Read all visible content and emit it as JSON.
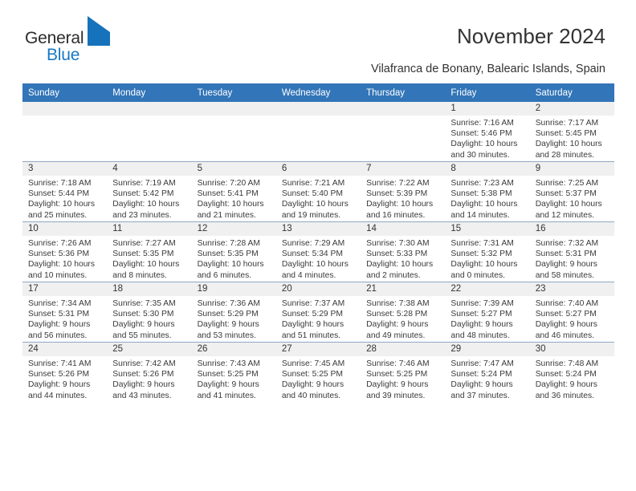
{
  "brand": {
    "name_part1": "General",
    "name_part2": "Blue",
    "accent_color": "#1673bb"
  },
  "header": {
    "title": "November 2024",
    "subtitle": "Vilafranca de Bonany, Balearic Islands, Spain"
  },
  "theme": {
    "header_row_bg": "#3275b8",
    "daynum_band_bg": "#f0f0f0",
    "grid_line": "#8fa8c4"
  },
  "weekday_headers": [
    "Sunday",
    "Monday",
    "Tuesday",
    "Wednesday",
    "Thursday",
    "Friday",
    "Saturday"
  ],
  "weeks": [
    [
      {
        "day": "",
        "empty": true
      },
      {
        "day": "",
        "empty": true
      },
      {
        "day": "",
        "empty": true
      },
      {
        "day": "",
        "empty": true
      },
      {
        "day": "",
        "empty": true
      },
      {
        "day": "1",
        "sunrise": "Sunrise: 7:16 AM",
        "sunset": "Sunset: 5:46 PM",
        "daylight_line1": "Daylight: 10 hours",
        "daylight_line2": "and 30 minutes."
      },
      {
        "day": "2",
        "sunrise": "Sunrise: 7:17 AM",
        "sunset": "Sunset: 5:45 PM",
        "daylight_line1": "Daylight: 10 hours",
        "daylight_line2": "and 28 minutes."
      }
    ],
    [
      {
        "day": "3",
        "sunrise": "Sunrise: 7:18 AM",
        "sunset": "Sunset: 5:44 PM",
        "daylight_line1": "Daylight: 10 hours",
        "daylight_line2": "and 25 minutes."
      },
      {
        "day": "4",
        "sunrise": "Sunrise: 7:19 AM",
        "sunset": "Sunset: 5:42 PM",
        "daylight_line1": "Daylight: 10 hours",
        "daylight_line2": "and 23 minutes."
      },
      {
        "day": "5",
        "sunrise": "Sunrise: 7:20 AM",
        "sunset": "Sunset: 5:41 PM",
        "daylight_line1": "Daylight: 10 hours",
        "daylight_line2": "and 21 minutes."
      },
      {
        "day": "6",
        "sunrise": "Sunrise: 7:21 AM",
        "sunset": "Sunset: 5:40 PM",
        "daylight_line1": "Daylight: 10 hours",
        "daylight_line2": "and 19 minutes."
      },
      {
        "day": "7",
        "sunrise": "Sunrise: 7:22 AM",
        "sunset": "Sunset: 5:39 PM",
        "daylight_line1": "Daylight: 10 hours",
        "daylight_line2": "and 16 minutes."
      },
      {
        "day": "8",
        "sunrise": "Sunrise: 7:23 AM",
        "sunset": "Sunset: 5:38 PM",
        "daylight_line1": "Daylight: 10 hours",
        "daylight_line2": "and 14 minutes."
      },
      {
        "day": "9",
        "sunrise": "Sunrise: 7:25 AM",
        "sunset": "Sunset: 5:37 PM",
        "daylight_line1": "Daylight: 10 hours",
        "daylight_line2": "and 12 minutes."
      }
    ],
    [
      {
        "day": "10",
        "sunrise": "Sunrise: 7:26 AM",
        "sunset": "Sunset: 5:36 PM",
        "daylight_line1": "Daylight: 10 hours",
        "daylight_line2": "and 10 minutes."
      },
      {
        "day": "11",
        "sunrise": "Sunrise: 7:27 AM",
        "sunset": "Sunset: 5:35 PM",
        "daylight_line1": "Daylight: 10 hours",
        "daylight_line2": "and 8 minutes."
      },
      {
        "day": "12",
        "sunrise": "Sunrise: 7:28 AM",
        "sunset": "Sunset: 5:35 PM",
        "daylight_line1": "Daylight: 10 hours",
        "daylight_line2": "and 6 minutes."
      },
      {
        "day": "13",
        "sunrise": "Sunrise: 7:29 AM",
        "sunset": "Sunset: 5:34 PM",
        "daylight_line1": "Daylight: 10 hours",
        "daylight_line2": "and 4 minutes."
      },
      {
        "day": "14",
        "sunrise": "Sunrise: 7:30 AM",
        "sunset": "Sunset: 5:33 PM",
        "daylight_line1": "Daylight: 10 hours",
        "daylight_line2": "and 2 minutes."
      },
      {
        "day": "15",
        "sunrise": "Sunrise: 7:31 AM",
        "sunset": "Sunset: 5:32 PM",
        "daylight_line1": "Daylight: 10 hours",
        "daylight_line2": "and 0 minutes."
      },
      {
        "day": "16",
        "sunrise": "Sunrise: 7:32 AM",
        "sunset": "Sunset: 5:31 PM",
        "daylight_line1": "Daylight: 9 hours",
        "daylight_line2": "and 58 minutes."
      }
    ],
    [
      {
        "day": "17",
        "sunrise": "Sunrise: 7:34 AM",
        "sunset": "Sunset: 5:31 PM",
        "daylight_line1": "Daylight: 9 hours",
        "daylight_line2": "and 56 minutes."
      },
      {
        "day": "18",
        "sunrise": "Sunrise: 7:35 AM",
        "sunset": "Sunset: 5:30 PM",
        "daylight_line1": "Daylight: 9 hours",
        "daylight_line2": "and 55 minutes."
      },
      {
        "day": "19",
        "sunrise": "Sunrise: 7:36 AM",
        "sunset": "Sunset: 5:29 PM",
        "daylight_line1": "Daylight: 9 hours",
        "daylight_line2": "and 53 minutes."
      },
      {
        "day": "20",
        "sunrise": "Sunrise: 7:37 AM",
        "sunset": "Sunset: 5:29 PM",
        "daylight_line1": "Daylight: 9 hours",
        "daylight_line2": "and 51 minutes."
      },
      {
        "day": "21",
        "sunrise": "Sunrise: 7:38 AM",
        "sunset": "Sunset: 5:28 PM",
        "daylight_line1": "Daylight: 9 hours",
        "daylight_line2": "and 49 minutes."
      },
      {
        "day": "22",
        "sunrise": "Sunrise: 7:39 AM",
        "sunset": "Sunset: 5:27 PM",
        "daylight_line1": "Daylight: 9 hours",
        "daylight_line2": "and 48 minutes."
      },
      {
        "day": "23",
        "sunrise": "Sunrise: 7:40 AM",
        "sunset": "Sunset: 5:27 PM",
        "daylight_line1": "Daylight: 9 hours",
        "daylight_line2": "and 46 minutes."
      }
    ],
    [
      {
        "day": "24",
        "sunrise": "Sunrise: 7:41 AM",
        "sunset": "Sunset: 5:26 PM",
        "daylight_line1": "Daylight: 9 hours",
        "daylight_line2": "and 44 minutes."
      },
      {
        "day": "25",
        "sunrise": "Sunrise: 7:42 AM",
        "sunset": "Sunset: 5:26 PM",
        "daylight_line1": "Daylight: 9 hours",
        "daylight_line2": "and 43 minutes."
      },
      {
        "day": "26",
        "sunrise": "Sunrise: 7:43 AM",
        "sunset": "Sunset: 5:25 PM",
        "daylight_line1": "Daylight: 9 hours",
        "daylight_line2": "and 41 minutes."
      },
      {
        "day": "27",
        "sunrise": "Sunrise: 7:45 AM",
        "sunset": "Sunset: 5:25 PM",
        "daylight_line1": "Daylight: 9 hours",
        "daylight_line2": "and 40 minutes."
      },
      {
        "day": "28",
        "sunrise": "Sunrise: 7:46 AM",
        "sunset": "Sunset: 5:25 PM",
        "daylight_line1": "Daylight: 9 hours",
        "daylight_line2": "and 39 minutes."
      },
      {
        "day": "29",
        "sunrise": "Sunrise: 7:47 AM",
        "sunset": "Sunset: 5:24 PM",
        "daylight_line1": "Daylight: 9 hours",
        "daylight_line2": "and 37 minutes."
      },
      {
        "day": "30",
        "sunrise": "Sunrise: 7:48 AM",
        "sunset": "Sunset: 5:24 PM",
        "daylight_line1": "Daylight: 9 hours",
        "daylight_line2": "and 36 minutes."
      }
    ]
  ]
}
